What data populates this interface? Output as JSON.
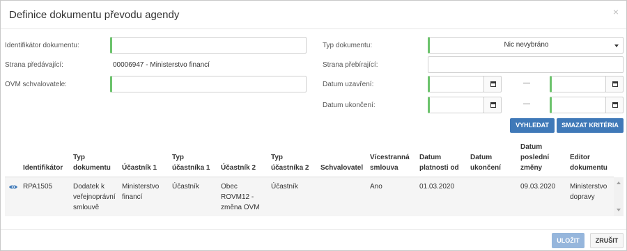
{
  "dialog": {
    "title": "Definice dokumentu převodu agendy",
    "close": "×"
  },
  "form": {
    "doc_id_label": "Identifikátor dokumentu:",
    "doc_id_value": "",
    "sender_label": "Strana předávající:",
    "sender_value": "00006947 - Ministerstvo financí",
    "ovm_label": "OVM schvalovatele:",
    "ovm_value": "",
    "doc_type_label": "Typ dokumentu:",
    "doc_type_value": "Nic nevybráno",
    "receiver_label": "Strana přebírající:",
    "receiver_value": "",
    "closed_date_label": "Datum uzavření:",
    "end_date_label": "Datum ukončení:",
    "range_sep": "—"
  },
  "buttons": {
    "search": "VYHLEDAT",
    "clear": "SMAZAT KRITÉRIA",
    "save": "ULOŽIT",
    "cancel": "ZRUŠIT"
  },
  "table": {
    "columns": [
      [
        "Identifikátor"
      ],
      [
        "Typ",
        "dokumentu"
      ],
      [
        "Účastník 1"
      ],
      [
        "Typ",
        "účastníka 1"
      ],
      [
        "Účastník 2"
      ],
      [
        "Typ",
        "účastníka 2"
      ],
      [
        "Schvalovatel"
      ],
      [
        "Vícestranná",
        "smlouva"
      ],
      [
        "Datum",
        "platnosti od"
      ],
      [
        "Datum",
        "ukončení"
      ],
      [
        "Datum",
        "poslední",
        "změny"
      ],
      [
        "Editor",
        "dokumentu"
      ]
    ],
    "rows": [
      {
        "icon": "eye-icon",
        "cells": [
          [
            "RPA1505"
          ],
          [
            "Dodatek k",
            "veřejnoprávní",
            "smlouvě"
          ],
          [
            "Ministerstvo",
            "financí"
          ],
          [
            "Účastník"
          ],
          [
            "Obec",
            "ROVM12 -",
            "změna OVM"
          ],
          [
            "Účastník"
          ],
          [
            ""
          ],
          [
            "Ano"
          ],
          [
            "01.03.2020"
          ],
          [
            ""
          ],
          [
            "09.03.2020"
          ],
          [
            "Ministerstvo",
            "dopravy"
          ]
        ]
      }
    ]
  },
  "colors": {
    "accent": "#3f79b8",
    "valid_border": "#6cc36c",
    "save_disabled": "#96b6dc"
  }
}
